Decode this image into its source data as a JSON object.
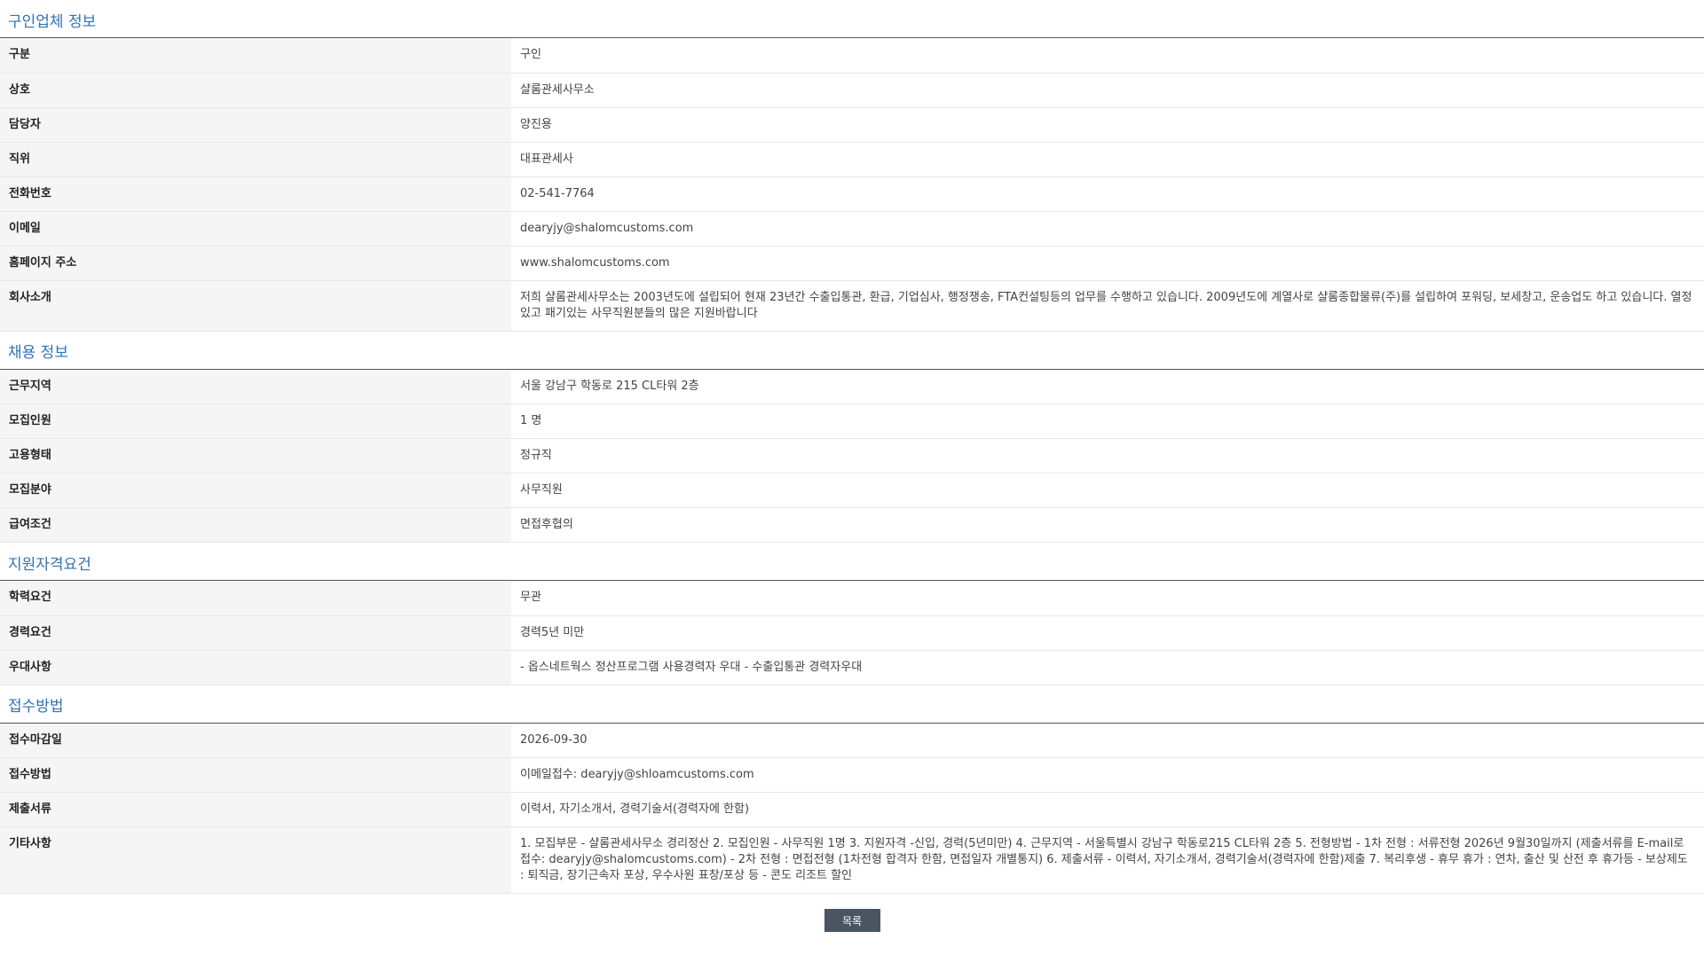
{
  "sections": [
    {
      "title": "구인업체 정보",
      "rows": [
        {
          "label": "구분",
          "value": "구인"
        },
        {
          "label": "상호",
          "value": "샬롬관세사무소"
        },
        {
          "label": "담당자",
          "value": "양진용"
        },
        {
          "label": "직위",
          "value": "대표관세사"
        },
        {
          "label": "전화번호",
          "value": "02-541-7764"
        },
        {
          "label": "이메일",
          "value": "dearyjy@shalomcustoms.com"
        },
        {
          "label": "홈페이지 주소",
          "value": "www.shalomcustoms.com"
        },
        {
          "label": "회사소개",
          "value": "저희 샬롬관세사무소는 2003년도에 설립되어 현재 23년간 수출입통관, 환급, 기업심사, 행정쟁송, FTA컨설팅등의 업무를 수행하고 있습니다. 2009년도에 계열사로 샬롬종합물류(주)를 설립하여 포워딩, 보세창고, 운송업도 하고 있습니다. 열정있고 패기있는 사무직원분들의 많은 지원바랍니다"
        }
      ]
    },
    {
      "title": "채용 정보",
      "rows": [
        {
          "label": "근무지역",
          "value": "서울 강남구 학동로 215 CL타워 2층"
        },
        {
          "label": "모집인원",
          "value": "1 명"
        },
        {
          "label": "고용형태",
          "value": "정규직"
        },
        {
          "label": "모집분야",
          "value": "사무직원"
        },
        {
          "label": "급여조건",
          "value": "면접후협의"
        }
      ]
    },
    {
      "title": "지원자격요건",
      "rows": [
        {
          "label": "학력요건",
          "value": "무관"
        },
        {
          "label": "경력요건",
          "value": "경력5년 미만"
        },
        {
          "label": "우대사항",
          "value": "- 옵스네트웍스 정산프로그램 사용경력자 우대 - 수출입통관 경력자우대"
        }
      ]
    },
    {
      "title": "접수방법",
      "rows": [
        {
          "label": "접수마감일",
          "value": "2026-09-30"
        },
        {
          "label": "접수방법",
          "value": "이메일접수: dearyjy@shloamcustoms.com"
        },
        {
          "label": "제출서류",
          "value": "이력서, 자기소개서, 경력기술서(경력자에 한함)"
        },
        {
          "label": "기타사항",
          "value": "1. 모집부문 - 샬롬관세사무소 경리정산 2. 모집인원 - 사무직원 1명 3. 지원자격 -신입, 경력(5년미만) 4. 근무지역 - 서울특별시 강남구 학동로215 CL타워 2층 5. 전형방법 - 1차 전형 : 서류전형 2026년 9월30일까지 (제출서류를 E-mail로 접수: dearyjy@shalomcustoms.com) - 2차 전형 : 면접전형 (1차전형 합격자 한함, 면접일자 개별통지) 6. 제출서류 - 이력서, 자기소개서, 경력기술서(경력자에 한함)제출 7. 복리후생 - 휴무 휴가 : 연차, 출산 및 산전 후 휴가등 - 보상제도 : 퇴직금, 장기근속자 포상, 우수사원 표창/포상 등 - 콘도 리조트 할인"
        }
      ]
    }
  ],
  "footer": {
    "list_button_label": "목록"
  }
}
